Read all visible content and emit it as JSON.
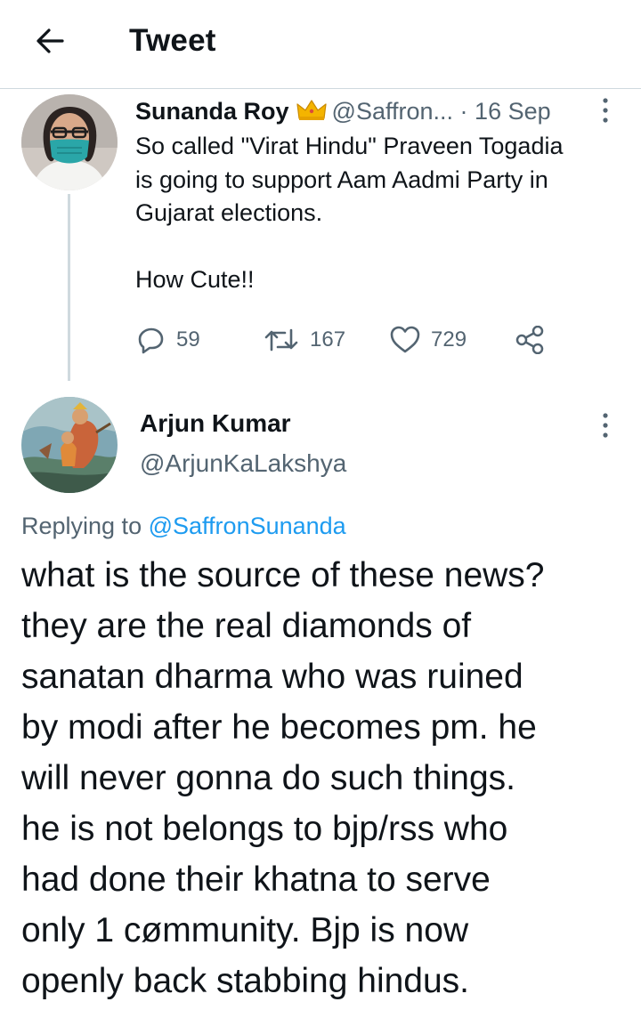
{
  "header": {
    "title": "Tweet",
    "back_icon": "arrow-left-icon"
  },
  "original_tweet": {
    "display_name": "Sunanda Roy",
    "badge_icon": "crown-icon",
    "handle": "@Saffron...",
    "separator": "·",
    "date": "16 Sep",
    "text": "So called \"Virat Hindu\" Praveen Togadia\nis going to support Aam Aadmi Party in\nGujarat elections.\n\nHow Cute!!",
    "actions": {
      "replies": "59",
      "retweets": "167",
      "likes": "729"
    }
  },
  "reply_tweet": {
    "display_name": "Arjun Kumar",
    "handle": "@ArjunKaLakshya",
    "replying_prefix": "Replying to",
    "replying_to": "@SaffronSunanda",
    "text": "what is the source of these news?\nthey are the real diamonds of\nsanatan dharma who was ruined\nby modi after he becomes pm. he\nwill never gonna do such things.\nhe is not belongs to bjp/rss who\nhad done their khatna to serve\nonly 1 cømmunity. Bjp is now\nopenly back stabbing hindus."
  },
  "colors": {
    "text_primary": "#0f1419",
    "text_secondary": "#536471",
    "link": "#1d9bf0",
    "divider": "#cfd9de",
    "crown_gold": "#f4b400"
  }
}
